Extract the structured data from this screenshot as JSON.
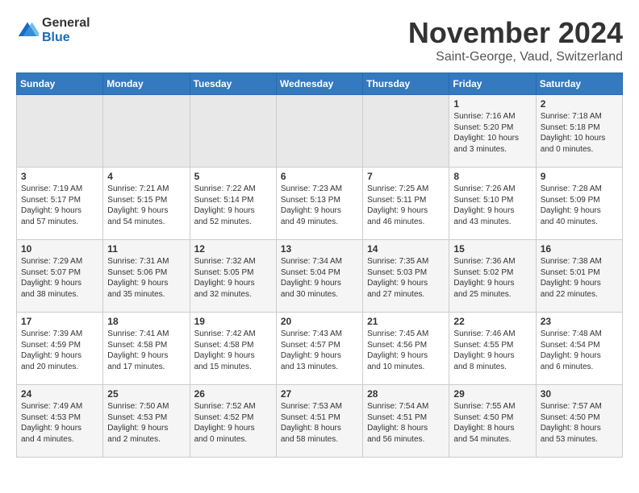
{
  "logo": {
    "general": "General",
    "blue": "Blue"
  },
  "header": {
    "month_title": "November 2024",
    "location": "Saint-George, Vaud, Switzerland"
  },
  "weekdays": [
    "Sunday",
    "Monday",
    "Tuesday",
    "Wednesday",
    "Thursday",
    "Friday",
    "Saturday"
  ],
  "weeks": [
    [
      {
        "day": "",
        "info": ""
      },
      {
        "day": "",
        "info": ""
      },
      {
        "day": "",
        "info": ""
      },
      {
        "day": "",
        "info": ""
      },
      {
        "day": "",
        "info": ""
      },
      {
        "day": "1",
        "info": "Sunrise: 7:16 AM\nSunset: 5:20 PM\nDaylight: 10 hours\nand 3 minutes."
      },
      {
        "day": "2",
        "info": "Sunrise: 7:18 AM\nSunset: 5:18 PM\nDaylight: 10 hours\nand 0 minutes."
      }
    ],
    [
      {
        "day": "3",
        "info": "Sunrise: 7:19 AM\nSunset: 5:17 PM\nDaylight: 9 hours\nand 57 minutes."
      },
      {
        "day": "4",
        "info": "Sunrise: 7:21 AM\nSunset: 5:15 PM\nDaylight: 9 hours\nand 54 minutes."
      },
      {
        "day": "5",
        "info": "Sunrise: 7:22 AM\nSunset: 5:14 PM\nDaylight: 9 hours\nand 52 minutes."
      },
      {
        "day": "6",
        "info": "Sunrise: 7:23 AM\nSunset: 5:13 PM\nDaylight: 9 hours\nand 49 minutes."
      },
      {
        "day": "7",
        "info": "Sunrise: 7:25 AM\nSunset: 5:11 PM\nDaylight: 9 hours\nand 46 minutes."
      },
      {
        "day": "8",
        "info": "Sunrise: 7:26 AM\nSunset: 5:10 PM\nDaylight: 9 hours\nand 43 minutes."
      },
      {
        "day": "9",
        "info": "Sunrise: 7:28 AM\nSunset: 5:09 PM\nDaylight: 9 hours\nand 40 minutes."
      }
    ],
    [
      {
        "day": "10",
        "info": "Sunrise: 7:29 AM\nSunset: 5:07 PM\nDaylight: 9 hours\nand 38 minutes."
      },
      {
        "day": "11",
        "info": "Sunrise: 7:31 AM\nSunset: 5:06 PM\nDaylight: 9 hours\nand 35 minutes."
      },
      {
        "day": "12",
        "info": "Sunrise: 7:32 AM\nSunset: 5:05 PM\nDaylight: 9 hours\nand 32 minutes."
      },
      {
        "day": "13",
        "info": "Sunrise: 7:34 AM\nSunset: 5:04 PM\nDaylight: 9 hours\nand 30 minutes."
      },
      {
        "day": "14",
        "info": "Sunrise: 7:35 AM\nSunset: 5:03 PM\nDaylight: 9 hours\nand 27 minutes."
      },
      {
        "day": "15",
        "info": "Sunrise: 7:36 AM\nSunset: 5:02 PM\nDaylight: 9 hours\nand 25 minutes."
      },
      {
        "day": "16",
        "info": "Sunrise: 7:38 AM\nSunset: 5:01 PM\nDaylight: 9 hours\nand 22 minutes."
      }
    ],
    [
      {
        "day": "17",
        "info": "Sunrise: 7:39 AM\nSunset: 4:59 PM\nDaylight: 9 hours\nand 20 minutes."
      },
      {
        "day": "18",
        "info": "Sunrise: 7:41 AM\nSunset: 4:58 PM\nDaylight: 9 hours\nand 17 minutes."
      },
      {
        "day": "19",
        "info": "Sunrise: 7:42 AM\nSunset: 4:58 PM\nDaylight: 9 hours\nand 15 minutes."
      },
      {
        "day": "20",
        "info": "Sunrise: 7:43 AM\nSunset: 4:57 PM\nDaylight: 9 hours\nand 13 minutes."
      },
      {
        "day": "21",
        "info": "Sunrise: 7:45 AM\nSunset: 4:56 PM\nDaylight: 9 hours\nand 10 minutes."
      },
      {
        "day": "22",
        "info": "Sunrise: 7:46 AM\nSunset: 4:55 PM\nDaylight: 9 hours\nand 8 minutes."
      },
      {
        "day": "23",
        "info": "Sunrise: 7:48 AM\nSunset: 4:54 PM\nDaylight: 9 hours\nand 6 minutes."
      }
    ],
    [
      {
        "day": "24",
        "info": "Sunrise: 7:49 AM\nSunset: 4:53 PM\nDaylight: 9 hours\nand 4 minutes."
      },
      {
        "day": "25",
        "info": "Sunrise: 7:50 AM\nSunset: 4:53 PM\nDaylight: 9 hours\nand 2 minutes."
      },
      {
        "day": "26",
        "info": "Sunrise: 7:52 AM\nSunset: 4:52 PM\nDaylight: 9 hours\nand 0 minutes."
      },
      {
        "day": "27",
        "info": "Sunrise: 7:53 AM\nSunset: 4:51 PM\nDaylight: 8 hours\nand 58 minutes."
      },
      {
        "day": "28",
        "info": "Sunrise: 7:54 AM\nSunset: 4:51 PM\nDaylight: 8 hours\nand 56 minutes."
      },
      {
        "day": "29",
        "info": "Sunrise: 7:55 AM\nSunset: 4:50 PM\nDaylight: 8 hours\nand 54 minutes."
      },
      {
        "day": "30",
        "info": "Sunrise: 7:57 AM\nSunset: 4:50 PM\nDaylight: 8 hours\nand 53 minutes."
      }
    ]
  ]
}
